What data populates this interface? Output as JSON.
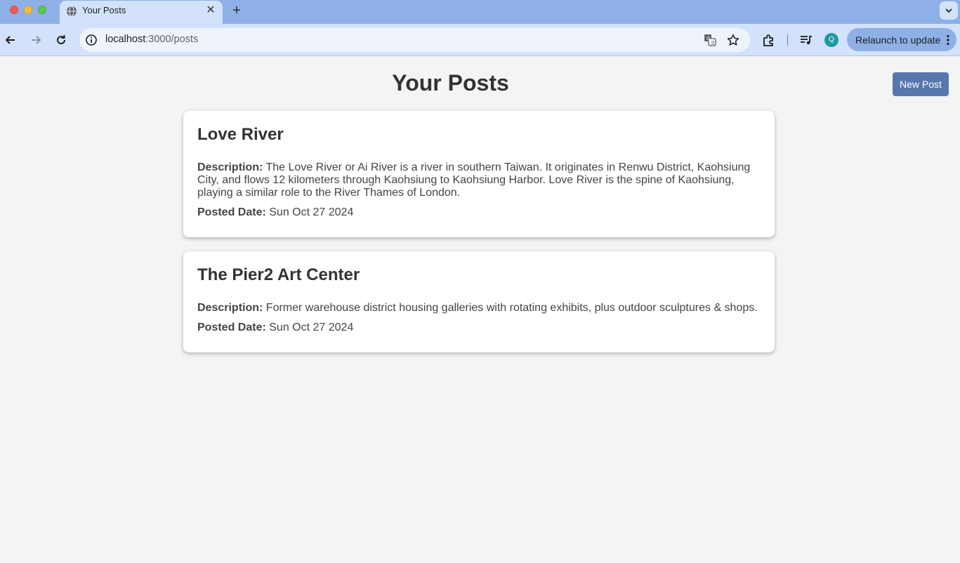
{
  "browser": {
    "tab_title": "Your Posts",
    "new_tab_symbol": "+",
    "url_host": "localhost",
    "url_path": ":3000/posts",
    "profile_initial": "Q",
    "relaunch_label": "Relaunch to update"
  },
  "page": {
    "title": "Your Posts",
    "new_post_label": "New Post"
  },
  "posts": [
    {
      "title": "Love River",
      "description_label": "Description:",
      "description": "The Love River or Ai River is a river in southern Taiwan. It originates in Renwu District, Kaohsiung City, and flows 12 kilometers through Kaohsiung to Kaohsiung Harbor. Love River is the spine of Kaohsiung, playing a similar role to the River Thames of London.",
      "date_label": "Posted Date:",
      "date": "Sun Oct 27 2024"
    },
    {
      "title": "The Pier2 Art Center",
      "description_label": "Description:",
      "description": "Former warehouse district housing galleries with rotating exhibits, plus outdoor sculptures & shops.",
      "date_label": "Posted Date:",
      "date": "Sun Oct 27 2024"
    }
  ],
  "colors": {
    "accent": "#5678ad",
    "tabbar": "#8eb0e7",
    "toolbar": "#d3e2fb",
    "page_bg": "#f4f4f4"
  },
  "icons": [
    "globe-icon",
    "close-icon",
    "plus-icon",
    "chevron-down-icon",
    "back-arrow-icon",
    "forward-arrow-icon",
    "reload-icon",
    "info-icon",
    "translate-icon",
    "star-icon",
    "extensions-icon",
    "media-controls-icon",
    "more-vert-icon"
  ]
}
